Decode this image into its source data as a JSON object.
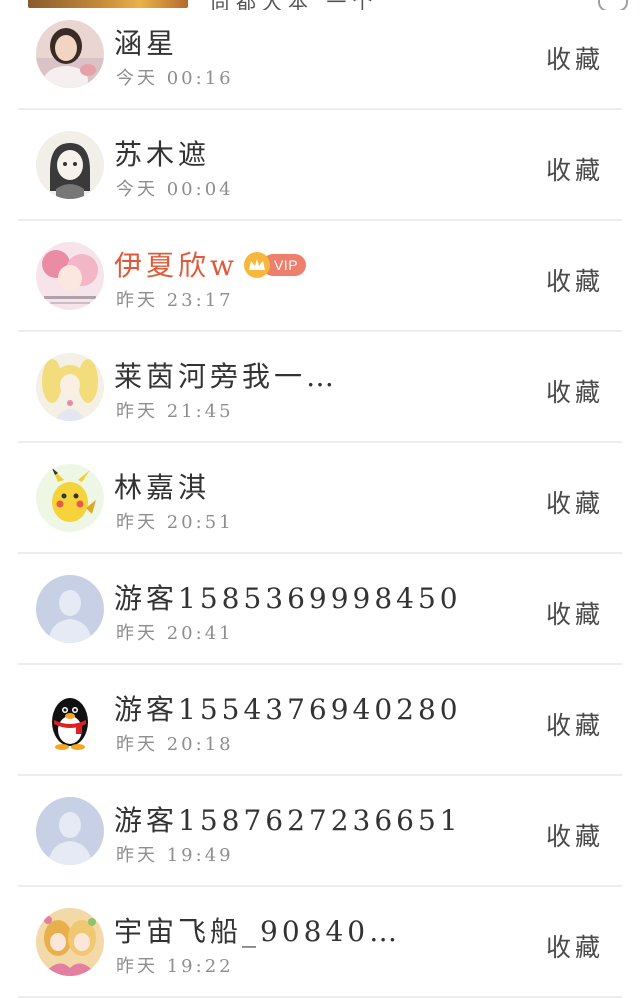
{
  "header": {
    "title_partial": "尚都大本 一个"
  },
  "favorite_label": "收藏",
  "vip_label": "VIP",
  "users": [
    {
      "name": "涵星",
      "time": "今天 00:16",
      "avatar": "photo-girl-avatar",
      "vip": false
    },
    {
      "name": "苏木遮",
      "time": "今天 00:04",
      "avatar": "sketch-girl-avatar",
      "vip": false
    },
    {
      "name": "伊夏欣w",
      "time": "昨天 23:17",
      "avatar": "pink-illustration-avatar",
      "vip": true
    },
    {
      "name": "莱茵河旁我一…",
      "time": "昨天 21:45",
      "avatar": "sailor-moon-avatar",
      "vip": false
    },
    {
      "name": "林嘉淇",
      "time": "昨天 20:51",
      "avatar": "pikachu-avatar",
      "vip": false
    },
    {
      "name": "游客1585369998450",
      "time": "昨天 20:41",
      "avatar": "default-guest-avatar",
      "vip": false
    },
    {
      "name": "游客1554376940280",
      "time": "昨天 20:18",
      "avatar": "qq-penguin-avatar",
      "vip": false
    },
    {
      "name": "游客1587627236651",
      "time": "昨天 19:49",
      "avatar": "default-guest-avatar",
      "vip": false
    },
    {
      "name": "宇宙飞船_90840…",
      "time": "昨天 19:22",
      "avatar": "anime-girls-avatar",
      "vip": false
    }
  ],
  "colors": {
    "name": "#333333",
    "vip_name": "#e05a3a",
    "time": "#8e8e8e",
    "divider": "#ededed",
    "vip_badge": "#ef7f6d",
    "crown": "#f6b73c"
  }
}
